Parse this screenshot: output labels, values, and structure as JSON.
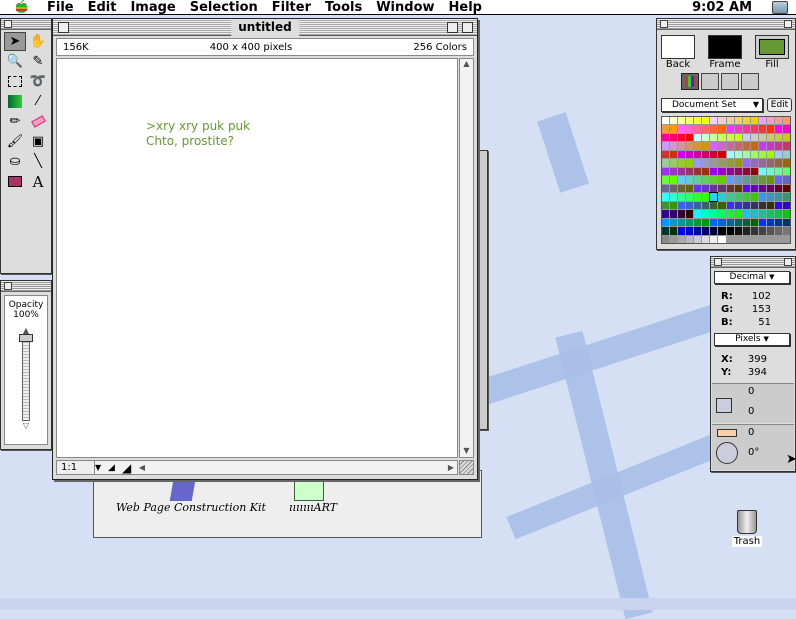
{
  "menubar": {
    "apple_icon": "apple-icon",
    "items": [
      "File",
      "Edit",
      "Image",
      "Selection",
      "Filter",
      "Tools",
      "Window",
      "Help"
    ],
    "clock": "9:02 AM"
  },
  "document": {
    "title": "untitled",
    "size": "156K",
    "dimensions": "400 x 400 pixels",
    "colors": "256 Colors",
    "text_lines": [
      ">xry xry puk puk",
      "Chto, prostite?"
    ],
    "text_color": "#669933",
    "zoom": "1:1"
  },
  "opacity": {
    "label": "Opacity",
    "value": "100%"
  },
  "colors_palette": {
    "back_label": "Back",
    "frame_label": "Frame",
    "fill_label": "Fill",
    "back_color": "#ffffff",
    "frame_color": "#000000",
    "fill_color": "#669933",
    "set_select": "Document Set",
    "edit_button": "Edit"
  },
  "info": {
    "mode": "Decimal",
    "r_label": "R:",
    "r": "102",
    "g_label": "G:",
    "g": "153",
    "b_label": "B:",
    "b": "51",
    "units": "Pixels",
    "x_label": "X:",
    "x": "399",
    "y_label": "Y:",
    "y": "394",
    "w": "0",
    "h": "0",
    "dist": "0",
    "angle": "0°"
  },
  "behind_window": {
    "item1": "Web Page Construction Kit",
    "item2": "ıııııııART"
  },
  "desktop": {
    "trash_label": "Trash"
  }
}
